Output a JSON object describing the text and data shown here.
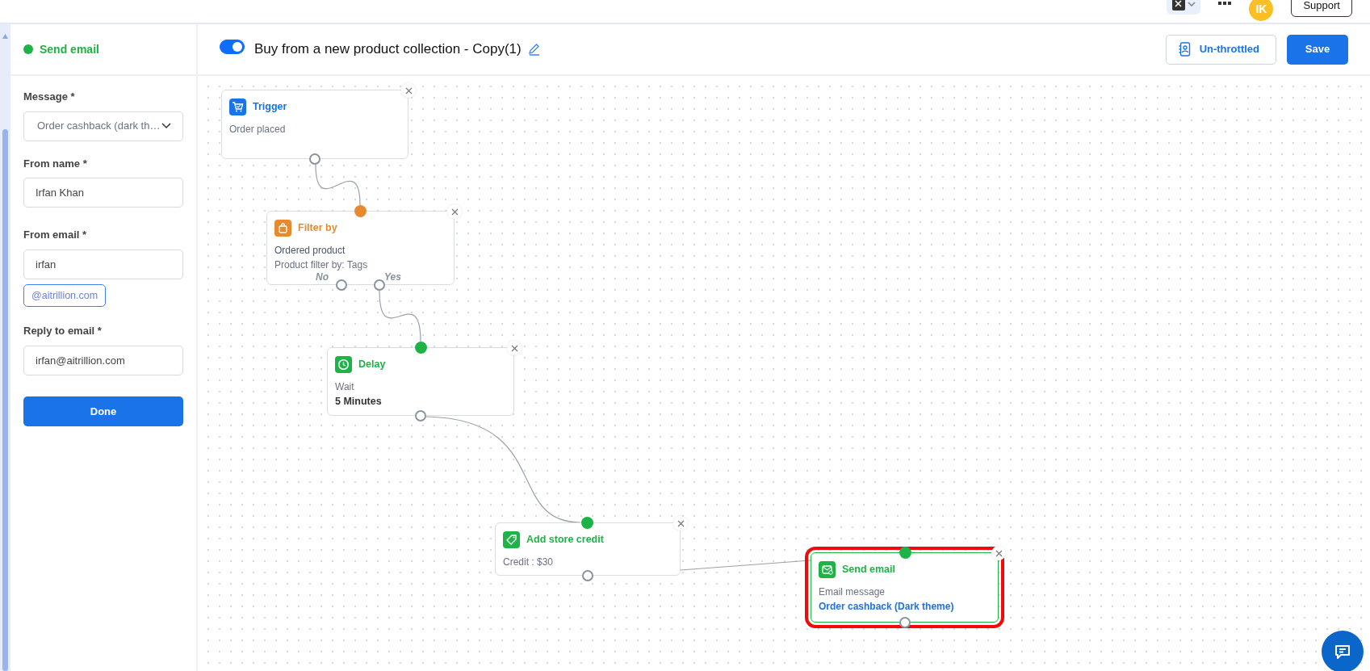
{
  "top_bar": {
    "avatar": "IK",
    "support_button": "Support"
  },
  "side_panel": {
    "title": "Send email",
    "fields": [
      {
        "kind": "select",
        "label": "Message *",
        "value": "Order cashback (dark th…"
      },
      {
        "kind": "text",
        "label": "From name *",
        "value": "Irfan Khan"
      },
      {
        "kind": "text",
        "label": "From email *",
        "value": "irfan",
        "suffix": "@aitrillion.com"
      },
      {
        "kind": "text",
        "label": "Reply to email *",
        "value": "irfan@aitrillion.com"
      }
    ],
    "done_button": "Done"
  },
  "workflow": {
    "enabled": true,
    "title": "Buy from a new product collection - Copy(1)",
    "throttle_button": "Un-throttled",
    "save_button": "Save",
    "nodes": [
      {
        "kind": "trigger",
        "title": "Trigger",
        "color": "#1a73e8",
        "selected": false,
        "lines": [
          {
            "kind": "muted",
            "text": "Order placed"
          }
        ]
      },
      {
        "kind": "filter",
        "title": "Filter by",
        "color": "#e8892b",
        "selected": false,
        "lines": [
          {
            "kind": "text",
            "text": "Ordered product"
          },
          {
            "kind": "muted",
            "text": "Product filter by: Tags"
          }
        ],
        "branches": [
          "No",
          "Yes"
        ]
      },
      {
        "kind": "delay",
        "title": "Delay",
        "color": "#1db347",
        "selected": false,
        "lines": [
          {
            "kind": "muted",
            "text": "Wait"
          },
          {
            "kind": "strong",
            "text": "5 Minutes"
          }
        ]
      },
      {
        "kind": "credit",
        "title": "Add store credit",
        "color": "#1db347",
        "selected": false,
        "lines": [
          {
            "kind": "muted",
            "text": "Credit : $30"
          }
        ]
      },
      {
        "kind": "email",
        "title": "Send email",
        "color": "#1db347",
        "selected": true,
        "lines": [
          {
            "kind": "muted",
            "text": "Email message"
          },
          {
            "kind": "link",
            "text": "Order cashback (Dark theme)"
          }
        ]
      }
    ]
  }
}
